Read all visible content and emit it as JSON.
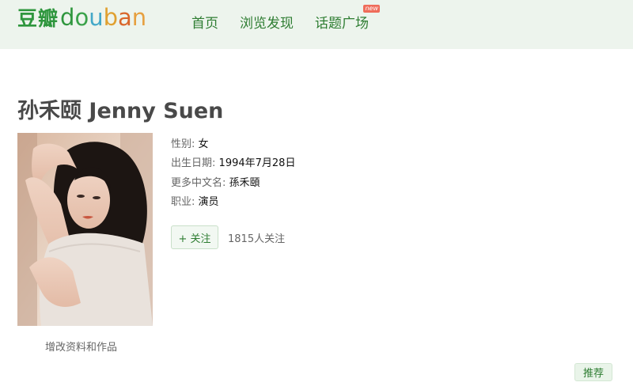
{
  "header": {
    "logo_cn": "豆瓣",
    "logo_en": [
      "d",
      "o",
      "u",
      "b",
      "a",
      "n"
    ],
    "nav": [
      {
        "label": "首页"
      },
      {
        "label": "浏览发现"
      },
      {
        "label": "话题广场",
        "badge": "new"
      }
    ]
  },
  "person": {
    "name": "孙禾颐 Jenny Suen",
    "photo_icon": "person-photo",
    "edit_link": "增改资料和作品",
    "info": [
      {
        "key": "性别",
        "value": "女"
      },
      {
        "key": "出生日期",
        "value": "1994年7月28日"
      },
      {
        "key": "更多中文名",
        "value": "孫禾頤"
      },
      {
        "key": "职业",
        "value": "演员"
      }
    ],
    "separator": ":",
    "follow_label": "+ 关注",
    "follow_count": "1815人关注"
  },
  "footer": {
    "recommend_label": "推荐"
  },
  "colors": {
    "brand_green": "#2e963d",
    "link_green": "#2e7d32",
    "header_bg": "#edf4ed"
  }
}
